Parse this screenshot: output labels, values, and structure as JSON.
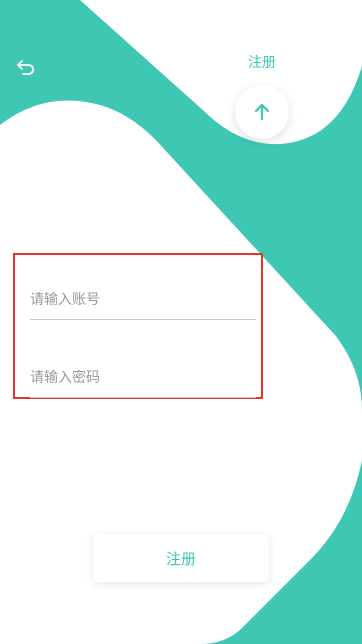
{
  "header": {
    "back_icon": "undo-arrow-icon",
    "register_label": "注册",
    "fab_icon": "arrow-up-icon"
  },
  "form": {
    "account_placeholder": "请输入账号",
    "account_value": "",
    "password_placeholder": "请输入密码",
    "password_value": ""
  },
  "submit": {
    "label": "注册"
  },
  "colors": {
    "accent": "#3ec8b4",
    "background": "#ffffff",
    "highlight_border": "#e53528"
  }
}
